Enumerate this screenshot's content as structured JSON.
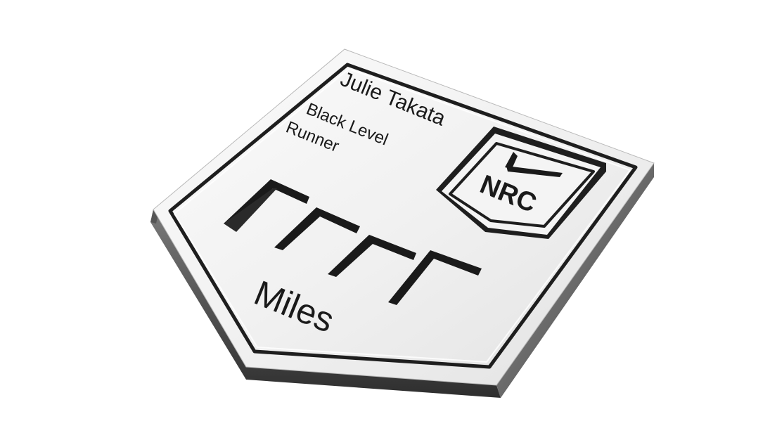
{
  "badge": {
    "name": "Julie Takata",
    "level_line1": "Black Level",
    "level_line2": "Runner",
    "unit": "Miles",
    "logo_text": "NRC",
    "digit_slots": 4
  },
  "colors": {
    "background": "#ffffff",
    "metal_face": "#f0f0f0",
    "metal_edge": "#4a4a4a",
    "groove": "#1e1e1e"
  }
}
